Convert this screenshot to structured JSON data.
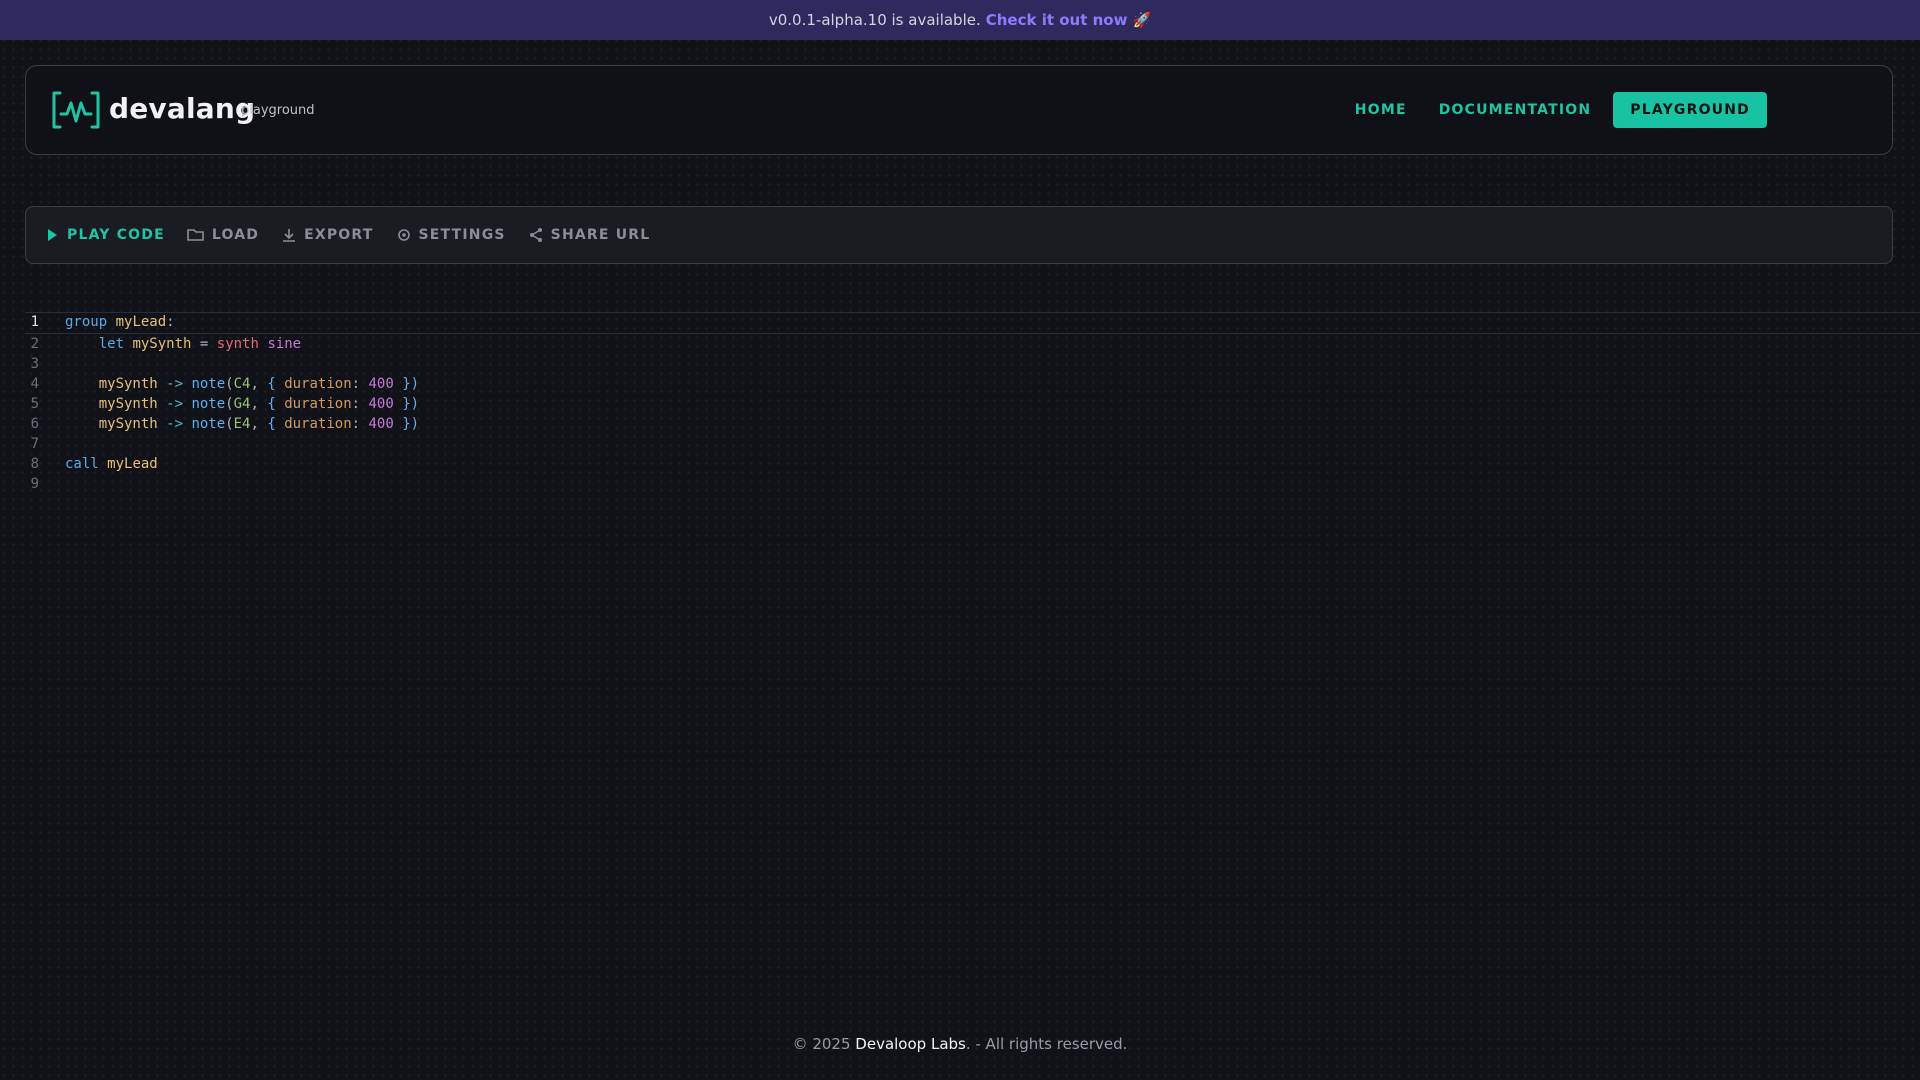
{
  "banner": {
    "message": "v0.0.1-alpha.10 is available.",
    "link_text": "Check it out now",
    "emoji": "🚀"
  },
  "header": {
    "brand": "devalang",
    "subtitle": "playground",
    "nav": {
      "home": "HOME",
      "documentation": "DOCUMENTATION",
      "playground": "PLAYGROUND"
    }
  },
  "toolbar": {
    "play": {
      "label": "PLAY CODE",
      "icon": "play-icon"
    },
    "load": {
      "label": "LOAD",
      "icon": "folder-open-icon"
    },
    "export": {
      "label": "EXPORT",
      "icon": "download-icon"
    },
    "settings": {
      "label": "SETTINGS",
      "icon": "settings-icon"
    },
    "share": {
      "label": "SHARE URL",
      "icon": "share-icon"
    }
  },
  "editor": {
    "lines": [
      {
        "n": "1",
        "parts": [
          {
            "t": "group",
            "c": "kw"
          },
          {
            "t": " ",
            "c": ""
          },
          {
            "t": "myLead",
            "c": "id"
          },
          {
            "t": ":",
            "c": "punc"
          }
        ]
      },
      {
        "n": "2",
        "parts": [
          {
            "t": "    ",
            "c": ""
          },
          {
            "t": "let",
            "c": "kw"
          },
          {
            "t": " ",
            "c": ""
          },
          {
            "t": "mySynth",
            "c": "id"
          },
          {
            "t": " = ",
            "c": "punc"
          },
          {
            "t": "synth",
            "c": "fn"
          },
          {
            "t": " ",
            "c": ""
          },
          {
            "t": "sine",
            "c": "wave"
          }
        ]
      },
      {
        "n": "3",
        "parts": []
      },
      {
        "n": "4",
        "parts": [
          {
            "t": "    ",
            "c": ""
          },
          {
            "t": "mySynth",
            "c": "id"
          },
          {
            "t": " -> ",
            "c": "op"
          },
          {
            "t": "note",
            "c": "call"
          },
          {
            "t": "(",
            "c": "punc"
          },
          {
            "t": "C4",
            "c": "lit"
          },
          {
            "t": ", ",
            "c": "punc"
          },
          {
            "t": "{ ",
            "c": "brace"
          },
          {
            "t": "duration",
            "c": "prop"
          },
          {
            "t": ": ",
            "c": "punc"
          },
          {
            "t": "400",
            "c": "num"
          },
          {
            "t": " })",
            "c": "brace"
          }
        ]
      },
      {
        "n": "5",
        "parts": [
          {
            "t": "    ",
            "c": ""
          },
          {
            "t": "mySynth",
            "c": "id"
          },
          {
            "t": " -> ",
            "c": "op"
          },
          {
            "t": "note",
            "c": "call"
          },
          {
            "t": "(",
            "c": "punc"
          },
          {
            "t": "G4",
            "c": "lit"
          },
          {
            "t": ", ",
            "c": "punc"
          },
          {
            "t": "{ ",
            "c": "brace"
          },
          {
            "t": "duration",
            "c": "prop"
          },
          {
            "t": ": ",
            "c": "punc"
          },
          {
            "t": "400",
            "c": "num"
          },
          {
            "t": " })",
            "c": "brace"
          }
        ]
      },
      {
        "n": "6",
        "parts": [
          {
            "t": "    ",
            "c": ""
          },
          {
            "t": "mySynth",
            "c": "id"
          },
          {
            "t": " -> ",
            "c": "op"
          },
          {
            "t": "note",
            "c": "call"
          },
          {
            "t": "(",
            "c": "punc"
          },
          {
            "t": "E4",
            "c": "lit"
          },
          {
            "t": ", ",
            "c": "punc"
          },
          {
            "t": "{ ",
            "c": "brace"
          },
          {
            "t": "duration",
            "c": "prop"
          },
          {
            "t": ": ",
            "c": "punc"
          },
          {
            "t": "400",
            "c": "num"
          },
          {
            "t": " })",
            "c": "brace"
          }
        ]
      },
      {
        "n": "7",
        "parts": []
      },
      {
        "n": "8",
        "parts": [
          {
            "t": "call",
            "c": "kw"
          },
          {
            "t": " ",
            "c": ""
          },
          {
            "t": "myLead",
            "c": "id"
          }
        ]
      },
      {
        "n": "9",
        "parts": []
      }
    ]
  },
  "footer": {
    "prefix": "© 2025",
    "brand": "Devaloop Labs",
    "suffix": ". - All rights reserved."
  },
  "colors": {
    "accent": "#17c3a3",
    "banner_bg": "#2e2a5e",
    "banner_link": "#8f7bff",
    "background": "#111218"
  }
}
